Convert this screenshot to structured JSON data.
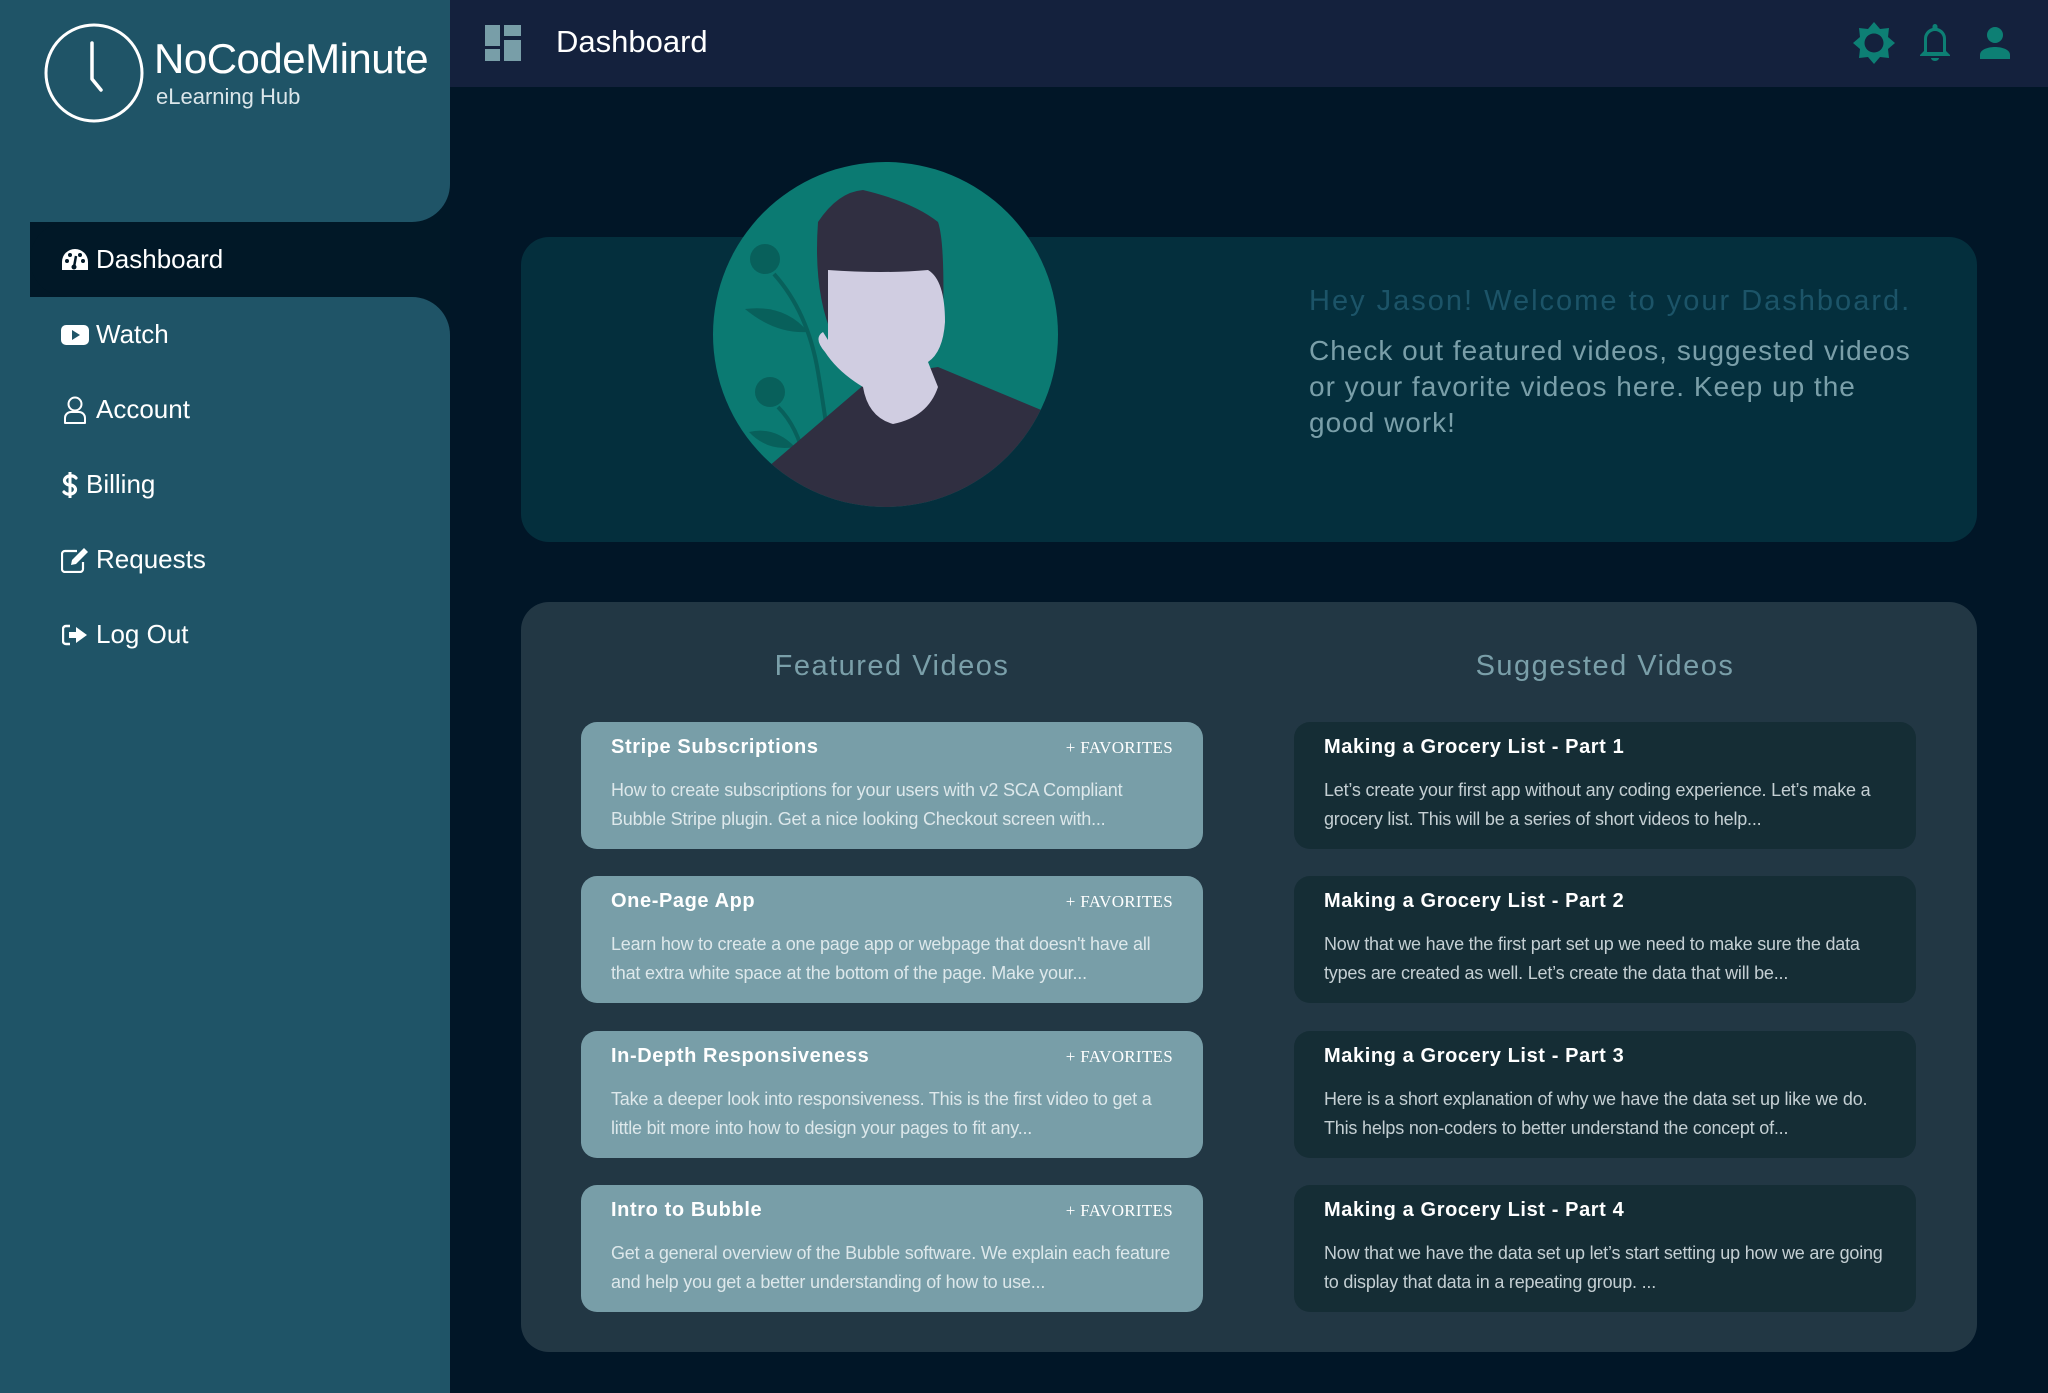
{
  "brand": {
    "name": "NoCodeMinute",
    "tagline": "eLearning Hub"
  },
  "sidebar": {
    "items": [
      {
        "label": "Dashboard",
        "icon": "dashboard-gauge-icon",
        "active": true
      },
      {
        "label": "Watch",
        "icon": "youtube-play-icon",
        "active": false
      },
      {
        "label": "Account",
        "icon": "user-outline-icon",
        "active": false
      },
      {
        "label": "Billing",
        "icon": "dollar-icon",
        "active": false
      },
      {
        "label": "Requests",
        "icon": "edit-icon",
        "active": false
      },
      {
        "label": "Log Out",
        "icon": "sign-out-icon",
        "active": false
      }
    ]
  },
  "header": {
    "title": "Dashboard",
    "icons": [
      "brightness-icon",
      "bell-icon",
      "user-icon"
    ]
  },
  "hero": {
    "title": "Hey Jason! Welcome to your Dashboard.",
    "body": "Check out featured videos, suggested videos or your favorite videos here. Keep up the good work!"
  },
  "featured": {
    "heading": "Featured Videos",
    "favorites_label": "+ FAVORITES",
    "items": [
      {
        "title": "Stripe Subscriptions",
        "description": "How to create subscriptions for your users with v2 SCA Compliant Bubble Stripe plugin. Get a nice looking Checkout screen with..."
      },
      {
        "title": "One-Page App",
        "description": "Learn how to create a one page app or webpage that doesn't have all that extra white space at the bottom of the page. Make your..."
      },
      {
        "title": "In-Depth Responsiveness",
        "description": "Take a deeper look into responsiveness. This is the first video to get a little bit more into how to design your pages to fit any..."
      },
      {
        "title": "Intro to Bubble",
        "description": "Get a general overview of the Bubble software. We explain each feature and help you get a better understanding of how to use..."
      }
    ]
  },
  "suggested": {
    "heading": "Suggested Videos",
    "items": [
      {
        "title": "Making a Grocery List - Part 1",
        "description": "Let’s create your first app without any coding experience. Let’s make a grocery list. This will be a series of short videos to help..."
      },
      {
        "title": "Making a Grocery List - Part 2",
        "description": "Now that we have the first part set up we need to make sure the data types are created as well. Let’s create the data that will be..."
      },
      {
        "title": "Making a Grocery List - Part 3",
        "description": "Here is a short explanation of why we have the data set up like we do. This helps non-coders to better understand the concept of..."
      },
      {
        "title": "Making a Grocery List - Part 4",
        "description": "Now that we have the data set up let’s start setting up how we are going to display that data in a repeating group. ..."
      }
    ]
  },
  "colors": {
    "sidebar": "#1f5467",
    "header": "#14213d",
    "background": "#011627",
    "accent": "#0d7f74",
    "featured_card": "#789ea8",
    "suggested_card": "#152d35"
  }
}
